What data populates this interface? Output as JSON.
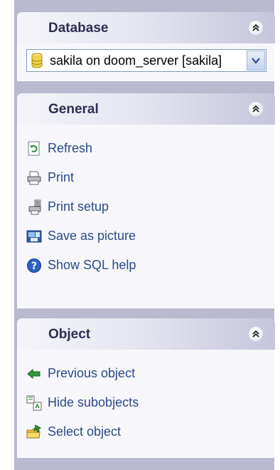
{
  "database": {
    "title": "Database",
    "collapse_icon": "chevron-double-up-icon",
    "selected": "sakila on doom_server [sakila]"
  },
  "general": {
    "title": "General",
    "collapse_icon": "chevron-double-up-icon",
    "items": [
      {
        "label": "Refresh",
        "icon": "refresh-icon"
      },
      {
        "label": "Print",
        "icon": "printer-icon"
      },
      {
        "label": "Print setup",
        "icon": "print-setup-icon"
      },
      {
        "label": "Save as picture",
        "icon": "save-picture-icon"
      },
      {
        "label": "Show SQL help",
        "icon": "help-icon"
      }
    ]
  },
  "object": {
    "title": "Object",
    "collapse_icon": "chevron-double-up-icon",
    "items": [
      {
        "label": "Previous object",
        "icon": "back-arrow-icon"
      },
      {
        "label": "Hide subobjects",
        "icon": "hide-subobjects-icon"
      },
      {
        "label": "Select object",
        "icon": "select-folder-icon"
      }
    ]
  },
  "colors": {
    "panel_bg": "#b9b9cf",
    "header_text": "#2e2e55",
    "link_text": "#2b4a8a"
  }
}
